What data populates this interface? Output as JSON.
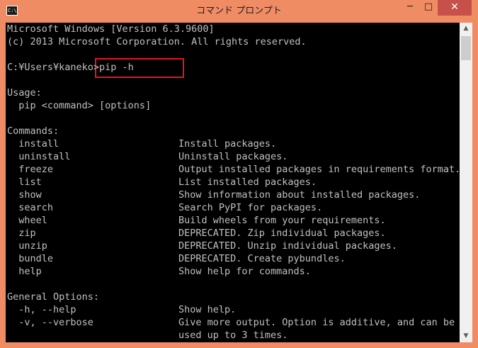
{
  "window": {
    "title": "コマンド プロンプト",
    "icon_text": "C:\\",
    "minimize_glyph": "─",
    "maximize_glyph": "□",
    "close_glyph": "✕"
  },
  "console": {
    "lines": [
      "Microsoft Windows [Version 6.3.9600]",
      "(c) 2013 Microsoft Corporation. All rights reserved.",
      "",
      "C:¥Users¥kaneko>pip -h",
      "",
      "Usage:",
      "  pip <command> [options]",
      "",
      "Commands:"
    ],
    "commands": [
      {
        "name": "  install",
        "desc": "Install packages."
      },
      {
        "name": "  uninstall",
        "desc": "Uninstall packages."
      },
      {
        "name": "  freeze",
        "desc": "Output installed packages in requirements format."
      },
      {
        "name": "  list",
        "desc": "List installed packages."
      },
      {
        "name": "  show",
        "desc": "Show information about installed packages."
      },
      {
        "name": "  search",
        "desc": "Search PyPI for packages."
      },
      {
        "name": "  wheel",
        "desc": "Build wheels from your requirements."
      },
      {
        "name": "  zip",
        "desc": "DEPRECATED. Zip individual packages."
      },
      {
        "name": "  unzip",
        "desc": "DEPRECATED. Unzip individual packages."
      },
      {
        "name": "  bundle",
        "desc": "DEPRECATED. Create pybundles."
      },
      {
        "name": "  help",
        "desc": "Show help for commands."
      }
    ],
    "general_options_header": "General Options:",
    "options": [
      {
        "name": "  -h, --help",
        "desc": "Show help."
      },
      {
        "name": "  -v, --verbose",
        "desc": "Give more output. Option is additive, and can be"
      },
      {
        "name": "",
        "desc": "used up to 3 times."
      }
    ]
  },
  "colors": {
    "titlebar": "#f08c64",
    "console_bg": "#000000",
    "console_text": "#c0c0c0",
    "highlight_box": "#e8141c",
    "close_button": "#c7504b"
  },
  "scrollbar": {
    "up_glyph": "▲",
    "down_glyph": "▼"
  }
}
